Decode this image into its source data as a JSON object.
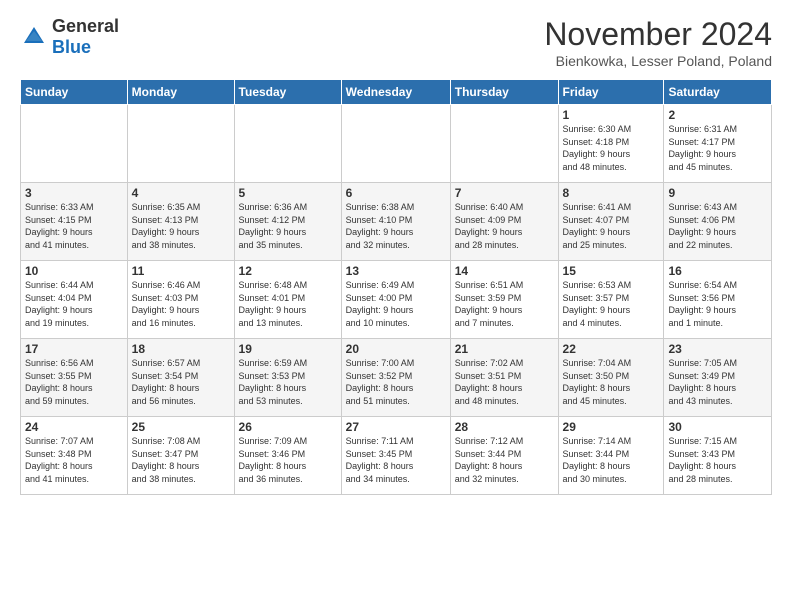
{
  "logo": {
    "general": "General",
    "blue": "Blue"
  },
  "header": {
    "month": "November 2024",
    "location": "Bienkowka, Lesser Poland, Poland"
  },
  "weekdays": [
    "Sunday",
    "Monday",
    "Tuesday",
    "Wednesday",
    "Thursday",
    "Friday",
    "Saturday"
  ],
  "weeks": [
    [
      {
        "day": "",
        "info": ""
      },
      {
        "day": "",
        "info": ""
      },
      {
        "day": "",
        "info": ""
      },
      {
        "day": "",
        "info": ""
      },
      {
        "day": "",
        "info": ""
      },
      {
        "day": "1",
        "info": "Sunrise: 6:30 AM\nSunset: 4:18 PM\nDaylight: 9 hours\nand 48 minutes."
      },
      {
        "day": "2",
        "info": "Sunrise: 6:31 AM\nSunset: 4:17 PM\nDaylight: 9 hours\nand 45 minutes."
      }
    ],
    [
      {
        "day": "3",
        "info": "Sunrise: 6:33 AM\nSunset: 4:15 PM\nDaylight: 9 hours\nand 41 minutes."
      },
      {
        "day": "4",
        "info": "Sunrise: 6:35 AM\nSunset: 4:13 PM\nDaylight: 9 hours\nand 38 minutes."
      },
      {
        "day": "5",
        "info": "Sunrise: 6:36 AM\nSunset: 4:12 PM\nDaylight: 9 hours\nand 35 minutes."
      },
      {
        "day": "6",
        "info": "Sunrise: 6:38 AM\nSunset: 4:10 PM\nDaylight: 9 hours\nand 32 minutes."
      },
      {
        "day": "7",
        "info": "Sunrise: 6:40 AM\nSunset: 4:09 PM\nDaylight: 9 hours\nand 28 minutes."
      },
      {
        "day": "8",
        "info": "Sunrise: 6:41 AM\nSunset: 4:07 PM\nDaylight: 9 hours\nand 25 minutes."
      },
      {
        "day": "9",
        "info": "Sunrise: 6:43 AM\nSunset: 4:06 PM\nDaylight: 9 hours\nand 22 minutes."
      }
    ],
    [
      {
        "day": "10",
        "info": "Sunrise: 6:44 AM\nSunset: 4:04 PM\nDaylight: 9 hours\nand 19 minutes."
      },
      {
        "day": "11",
        "info": "Sunrise: 6:46 AM\nSunset: 4:03 PM\nDaylight: 9 hours\nand 16 minutes."
      },
      {
        "day": "12",
        "info": "Sunrise: 6:48 AM\nSunset: 4:01 PM\nDaylight: 9 hours\nand 13 minutes."
      },
      {
        "day": "13",
        "info": "Sunrise: 6:49 AM\nSunset: 4:00 PM\nDaylight: 9 hours\nand 10 minutes."
      },
      {
        "day": "14",
        "info": "Sunrise: 6:51 AM\nSunset: 3:59 PM\nDaylight: 9 hours\nand 7 minutes."
      },
      {
        "day": "15",
        "info": "Sunrise: 6:53 AM\nSunset: 3:57 PM\nDaylight: 9 hours\nand 4 minutes."
      },
      {
        "day": "16",
        "info": "Sunrise: 6:54 AM\nSunset: 3:56 PM\nDaylight: 9 hours\nand 1 minute."
      }
    ],
    [
      {
        "day": "17",
        "info": "Sunrise: 6:56 AM\nSunset: 3:55 PM\nDaylight: 8 hours\nand 59 minutes."
      },
      {
        "day": "18",
        "info": "Sunrise: 6:57 AM\nSunset: 3:54 PM\nDaylight: 8 hours\nand 56 minutes."
      },
      {
        "day": "19",
        "info": "Sunrise: 6:59 AM\nSunset: 3:53 PM\nDaylight: 8 hours\nand 53 minutes."
      },
      {
        "day": "20",
        "info": "Sunrise: 7:00 AM\nSunset: 3:52 PM\nDaylight: 8 hours\nand 51 minutes."
      },
      {
        "day": "21",
        "info": "Sunrise: 7:02 AM\nSunset: 3:51 PM\nDaylight: 8 hours\nand 48 minutes."
      },
      {
        "day": "22",
        "info": "Sunrise: 7:04 AM\nSunset: 3:50 PM\nDaylight: 8 hours\nand 45 minutes."
      },
      {
        "day": "23",
        "info": "Sunrise: 7:05 AM\nSunset: 3:49 PM\nDaylight: 8 hours\nand 43 minutes."
      }
    ],
    [
      {
        "day": "24",
        "info": "Sunrise: 7:07 AM\nSunset: 3:48 PM\nDaylight: 8 hours\nand 41 minutes."
      },
      {
        "day": "25",
        "info": "Sunrise: 7:08 AM\nSunset: 3:47 PM\nDaylight: 8 hours\nand 38 minutes."
      },
      {
        "day": "26",
        "info": "Sunrise: 7:09 AM\nSunset: 3:46 PM\nDaylight: 8 hours\nand 36 minutes."
      },
      {
        "day": "27",
        "info": "Sunrise: 7:11 AM\nSunset: 3:45 PM\nDaylight: 8 hours\nand 34 minutes."
      },
      {
        "day": "28",
        "info": "Sunrise: 7:12 AM\nSunset: 3:44 PM\nDaylight: 8 hours\nand 32 minutes."
      },
      {
        "day": "29",
        "info": "Sunrise: 7:14 AM\nSunset: 3:44 PM\nDaylight: 8 hours\nand 30 minutes."
      },
      {
        "day": "30",
        "info": "Sunrise: 7:15 AM\nSunset: 3:43 PM\nDaylight: 8 hours\nand 28 minutes."
      }
    ]
  ]
}
